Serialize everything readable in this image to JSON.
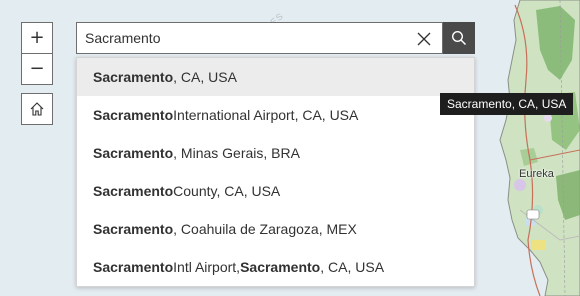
{
  "map": {
    "label_eureka": "Eureka",
    "watermark": "ES"
  },
  "controls": {
    "zoom_in": "+",
    "zoom_out": "−"
  },
  "search": {
    "value": "Sacramento",
    "suggestions": [
      {
        "parts": [
          {
            "text": "Sacramento",
            "bold": true
          },
          {
            "text": ", CA, USA",
            "bold": false
          }
        ]
      },
      {
        "parts": [
          {
            "text": "Sacramento",
            "bold": true
          },
          {
            "text": " International Airport, CA, USA",
            "bold": false
          }
        ]
      },
      {
        "parts": [
          {
            "text": "Sacramento",
            "bold": true
          },
          {
            "text": ", Minas Gerais, BRA",
            "bold": false
          }
        ]
      },
      {
        "parts": [
          {
            "text": "Sacramento",
            "bold": true
          },
          {
            "text": " County, CA, USA",
            "bold": false
          }
        ]
      },
      {
        "parts": [
          {
            "text": "Sacramento",
            "bold": true
          },
          {
            "text": ", Coahuila de Zaragoza, MEX",
            "bold": false
          }
        ]
      },
      {
        "parts": [
          {
            "text": "Sacramento",
            "bold": true
          },
          {
            "text": " Intl Airport, ",
            "bold": false
          },
          {
            "text": "Sacramento",
            "bold": true
          },
          {
            "text": ", CA, USA",
            "bold": false
          }
        ]
      }
    ]
  },
  "tooltip": {
    "text": "Sacramento, CA, USA"
  },
  "colors": {
    "search_button": "#4a4a4a",
    "active_row": "#ececec",
    "tooltip_bg": "#1e1e1e"
  }
}
